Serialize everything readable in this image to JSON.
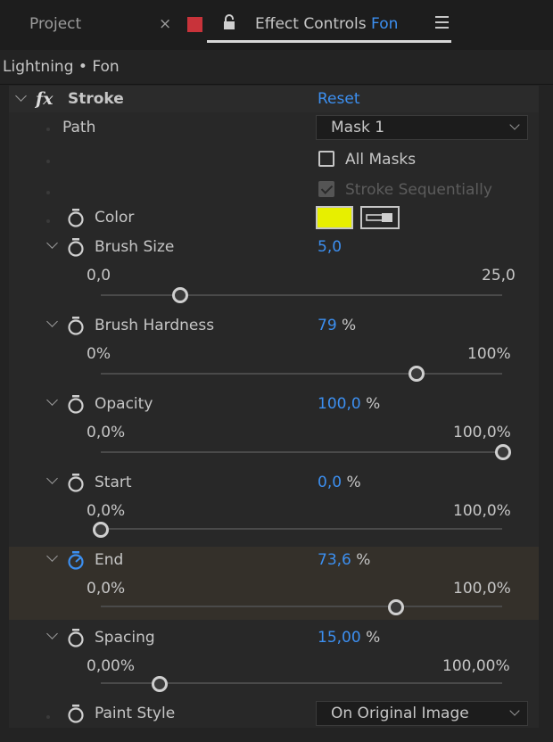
{
  "tabs": {
    "project": "Project",
    "close": "×",
    "effect_controls_prefix": "Effect Controls",
    "layer_name": "Fon",
    "tab_color": "#c8333a"
  },
  "breadcrumb": "Lightning • Fon",
  "effect": {
    "fx_label": "fx",
    "name": "Stroke",
    "reset": "Reset"
  },
  "path": {
    "label": "Path",
    "value": "Mask 1"
  },
  "all_masks": {
    "label": "All Masks",
    "checked": false
  },
  "stroke_sequentially": {
    "label": "Stroke Sequentially",
    "checked": true,
    "disabled": true
  },
  "color": {
    "label": "Color",
    "value_hex": "#e7ef00"
  },
  "brush_size": {
    "label": "Brush Size",
    "value": "5,0",
    "unit": "",
    "min": "0,0",
    "max": "25,0",
    "fraction": 0.2
  },
  "brush_hardness": {
    "label": "Brush Hardness",
    "value": "79",
    "unit": "%",
    "min": "0%",
    "max": "100%",
    "fraction": 0.79
  },
  "opacity": {
    "label": "Opacity",
    "value": "100,0",
    "unit": "%",
    "min": "0,0%",
    "max": "100,0%",
    "fraction": 1.0
  },
  "start": {
    "label": "Start",
    "value": "0,0",
    "unit": "%",
    "min": "0,0%",
    "max": "100,0%",
    "fraction": 0.0
  },
  "end": {
    "label": "End",
    "value": "73,6",
    "unit": "%",
    "min": "0,0%",
    "max": "100,0%",
    "fraction": 0.736
  },
  "spacing": {
    "label": "Spacing",
    "value": "15,00",
    "unit": "%",
    "min": "0,00%",
    "max": "100,00%",
    "fraction": 0.15
  },
  "paint_style": {
    "label": "Paint Style",
    "value": "On Original Image"
  }
}
